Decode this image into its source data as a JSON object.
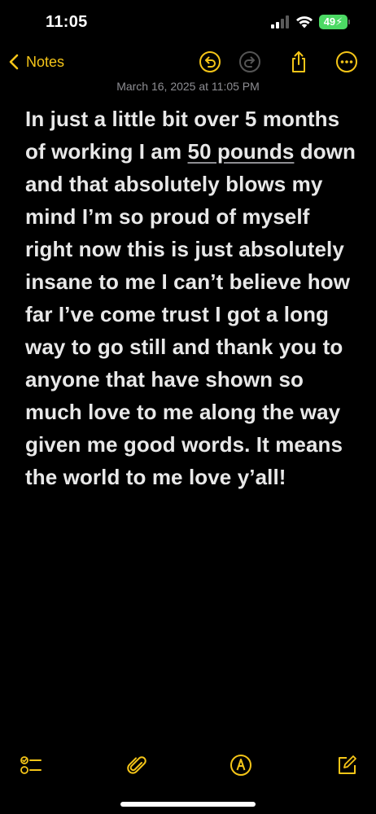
{
  "status_bar": {
    "time": "11:05",
    "battery_level": "49"
  },
  "nav": {
    "back_label": "Notes",
    "icons": {
      "undo": "undo-icon",
      "redo": "redo-icon",
      "share": "share-icon",
      "more": "more-icon"
    }
  },
  "note": {
    "date": "March 16, 2025 at 11:05 PM",
    "text_before_link": "In just a little bit over 5 months of working I am ",
    "link_text": "50 pounds",
    "text_after_link": " down and that absolutely blows my mind I’m so proud of myself right now this is just absolutely insane to me I can’t believe how far I’ve come trust I got a long way to go still and thank you to anyone that have shown so much love to me along the way given me good words. It means the world to me love y’all!"
  },
  "toolbar": {
    "icons": [
      "checklist-icon",
      "paperclip-icon",
      "markup-icon",
      "compose-icon"
    ]
  },
  "colors": {
    "accent": "#f5c518",
    "background": "#000000",
    "date_text": "#8e8e93",
    "body_text": "#e8e8e8",
    "battery": "#4cd964"
  }
}
